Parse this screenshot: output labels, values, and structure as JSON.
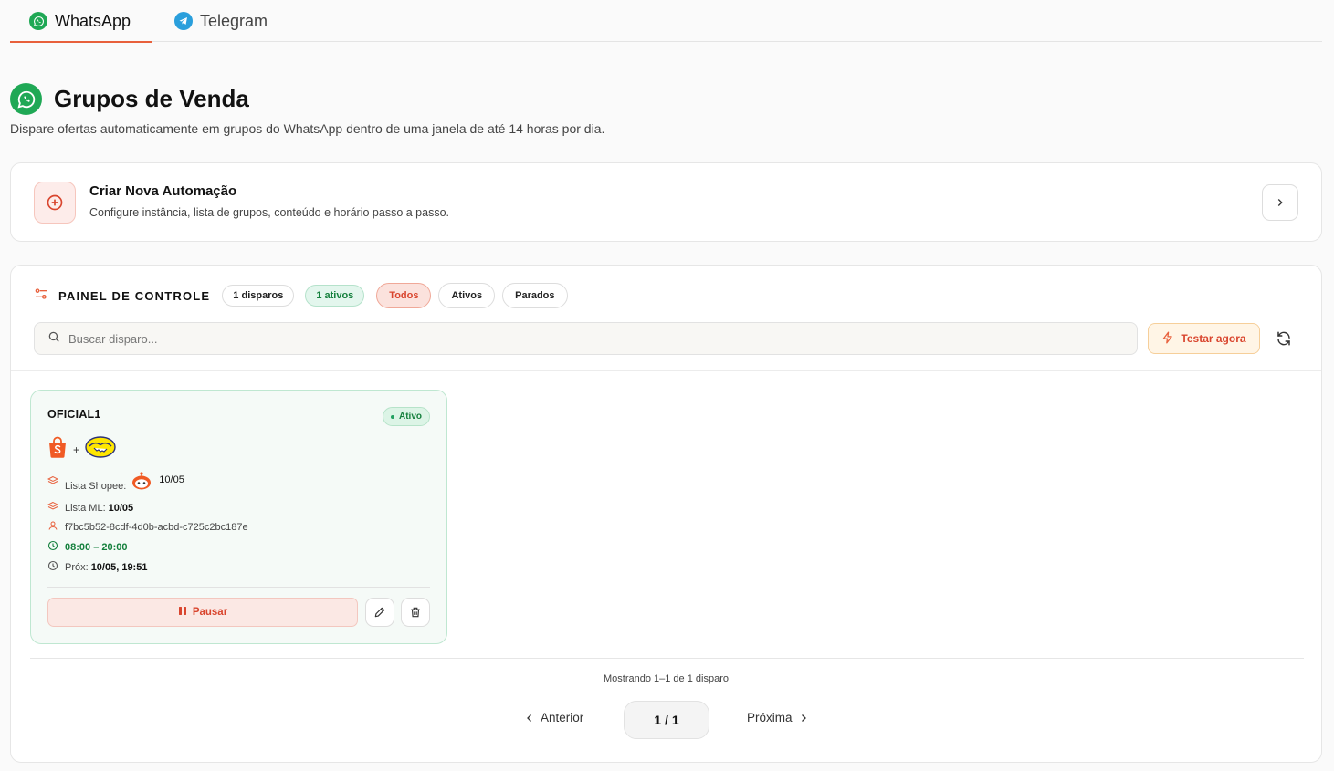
{
  "tabs": [
    {
      "label": "WhatsApp",
      "icon": "whatsapp-icon",
      "active": true
    },
    {
      "label": "Telegram",
      "icon": "telegram-icon",
      "active": false
    }
  ],
  "header": {
    "title": "Grupos de Venda",
    "description": "Dispare ofertas automaticamente em grupos do WhatsApp dentro de uma janela de até 14 horas por dia."
  },
  "create_card": {
    "title": "Criar Nova Automação",
    "subtitle": "Configure instância, lista de grupos, conteúdo e horário passo a passo."
  },
  "panel": {
    "title": "PAINEL DE CONTROLE",
    "count_disparos": "1 disparos",
    "count_ativos": "1 ativos",
    "filters": [
      "Todos",
      "Ativos",
      "Parados"
    ],
    "active_filter": "Todos",
    "search_placeholder": "Buscar disparo...",
    "test_button": "Testar agora"
  },
  "automation": {
    "name": "OFICIAL1",
    "status": "Ativo",
    "shopee_label": "Lista Shopee:",
    "shopee_value": "10/05",
    "ml_label": "Lista ML:",
    "ml_value": "10/05",
    "instance_id": "f7bc5b52-8cdf-4d0b-acbd-c725c2bc187e",
    "schedule": "08:00 – 20:00",
    "next_label": "Próx:",
    "next_value": "10/05, 19:51",
    "pause_label": "Pausar"
  },
  "pagination": {
    "showing": "Mostrando 1–1 de 1 disparo",
    "prev": "Anterior",
    "current": "1 / 1",
    "next": "Próxima"
  },
  "colors": {
    "accent": "#e8603c",
    "whatsapp_green": "#1fa855",
    "telegram_blue": "#2a9fdc",
    "active_green": "#15803d",
    "danger": "#d9452e"
  }
}
